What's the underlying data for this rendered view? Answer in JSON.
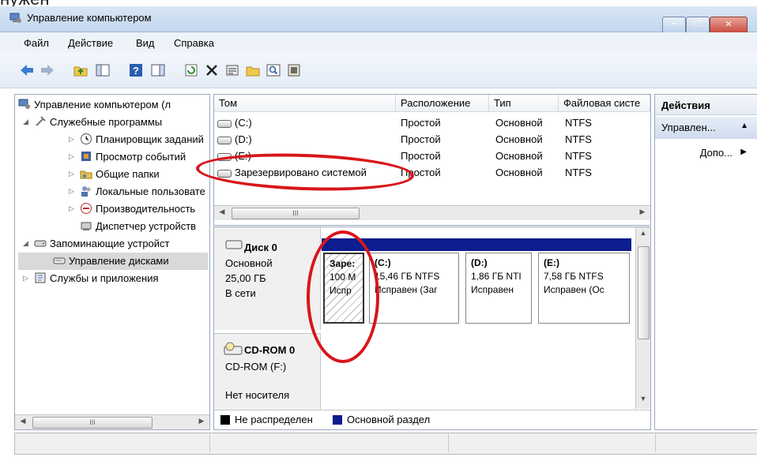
{
  "window": {
    "cut_text": "нужен",
    "title": "Управление компьютером",
    "min": "–",
    "max": "□",
    "close": "✕"
  },
  "menu": [
    "Файл",
    "Действие",
    "Вид",
    "Справка"
  ],
  "tree": {
    "root": "Управление компьютером (л",
    "items": [
      "Служебные программы",
      "Планировщик заданий",
      "Просмотр событий",
      "Общие папки",
      "Локальные пользовате",
      "Производительность",
      "Диспетчер устройств",
      "Запоминающие устройст",
      "Управление дисками",
      "Службы и приложения"
    ],
    "scroll_thumb": "III"
  },
  "volumes": {
    "headers": [
      "Том",
      "Расположение",
      "Тип",
      "Файловая систе"
    ],
    "rows": [
      {
        "name": "(C:)",
        "layout": "Простой",
        "type": "Основной",
        "fs": "NTFS"
      },
      {
        "name": "(D:)",
        "layout": "Простой",
        "type": "Основной",
        "fs": "NTFS"
      },
      {
        "name": "(E:)",
        "layout": "Простой",
        "type": "Основной",
        "fs": "NTFS"
      },
      {
        "name": "Зарезервировано системой",
        "layout": "Простой",
        "type": "Основной",
        "fs": "NTFS"
      }
    ],
    "scroll_thumb": "III"
  },
  "disks": {
    "disk0": {
      "name": "Диск 0",
      "type": "Основной",
      "size": "25,00 ГБ",
      "status": "В сети",
      "partitions": [
        {
          "label": "Заре:",
          "size": "100 M",
          "status": "Испр"
        },
        {
          "label": "(C:)",
          "size": "15,46 ГБ NTFS",
          "status": "Исправен (Заг"
        },
        {
          "label": "(D:)",
          "size": "1,86 ГБ NTI",
          "status": "Исправен"
        },
        {
          "label": "(E:)",
          "size": "7,58 ГБ NTFS",
          "status": "Исправен (Ос"
        }
      ]
    },
    "cdrom0": {
      "name": "CD-ROM 0",
      "type": "CD-ROM (F:)",
      "status": "Нет носителя"
    },
    "legend": {
      "unallocated": "Не распределен",
      "primary": "Основной раздел",
      "unallocated_color": "#000000",
      "primary_color": "#0b1d8f"
    }
  },
  "actions": {
    "header": "Действия",
    "section": "Управлен...",
    "more": "Допо..."
  },
  "accent": {
    "annotation_red": "#d8161a"
  }
}
